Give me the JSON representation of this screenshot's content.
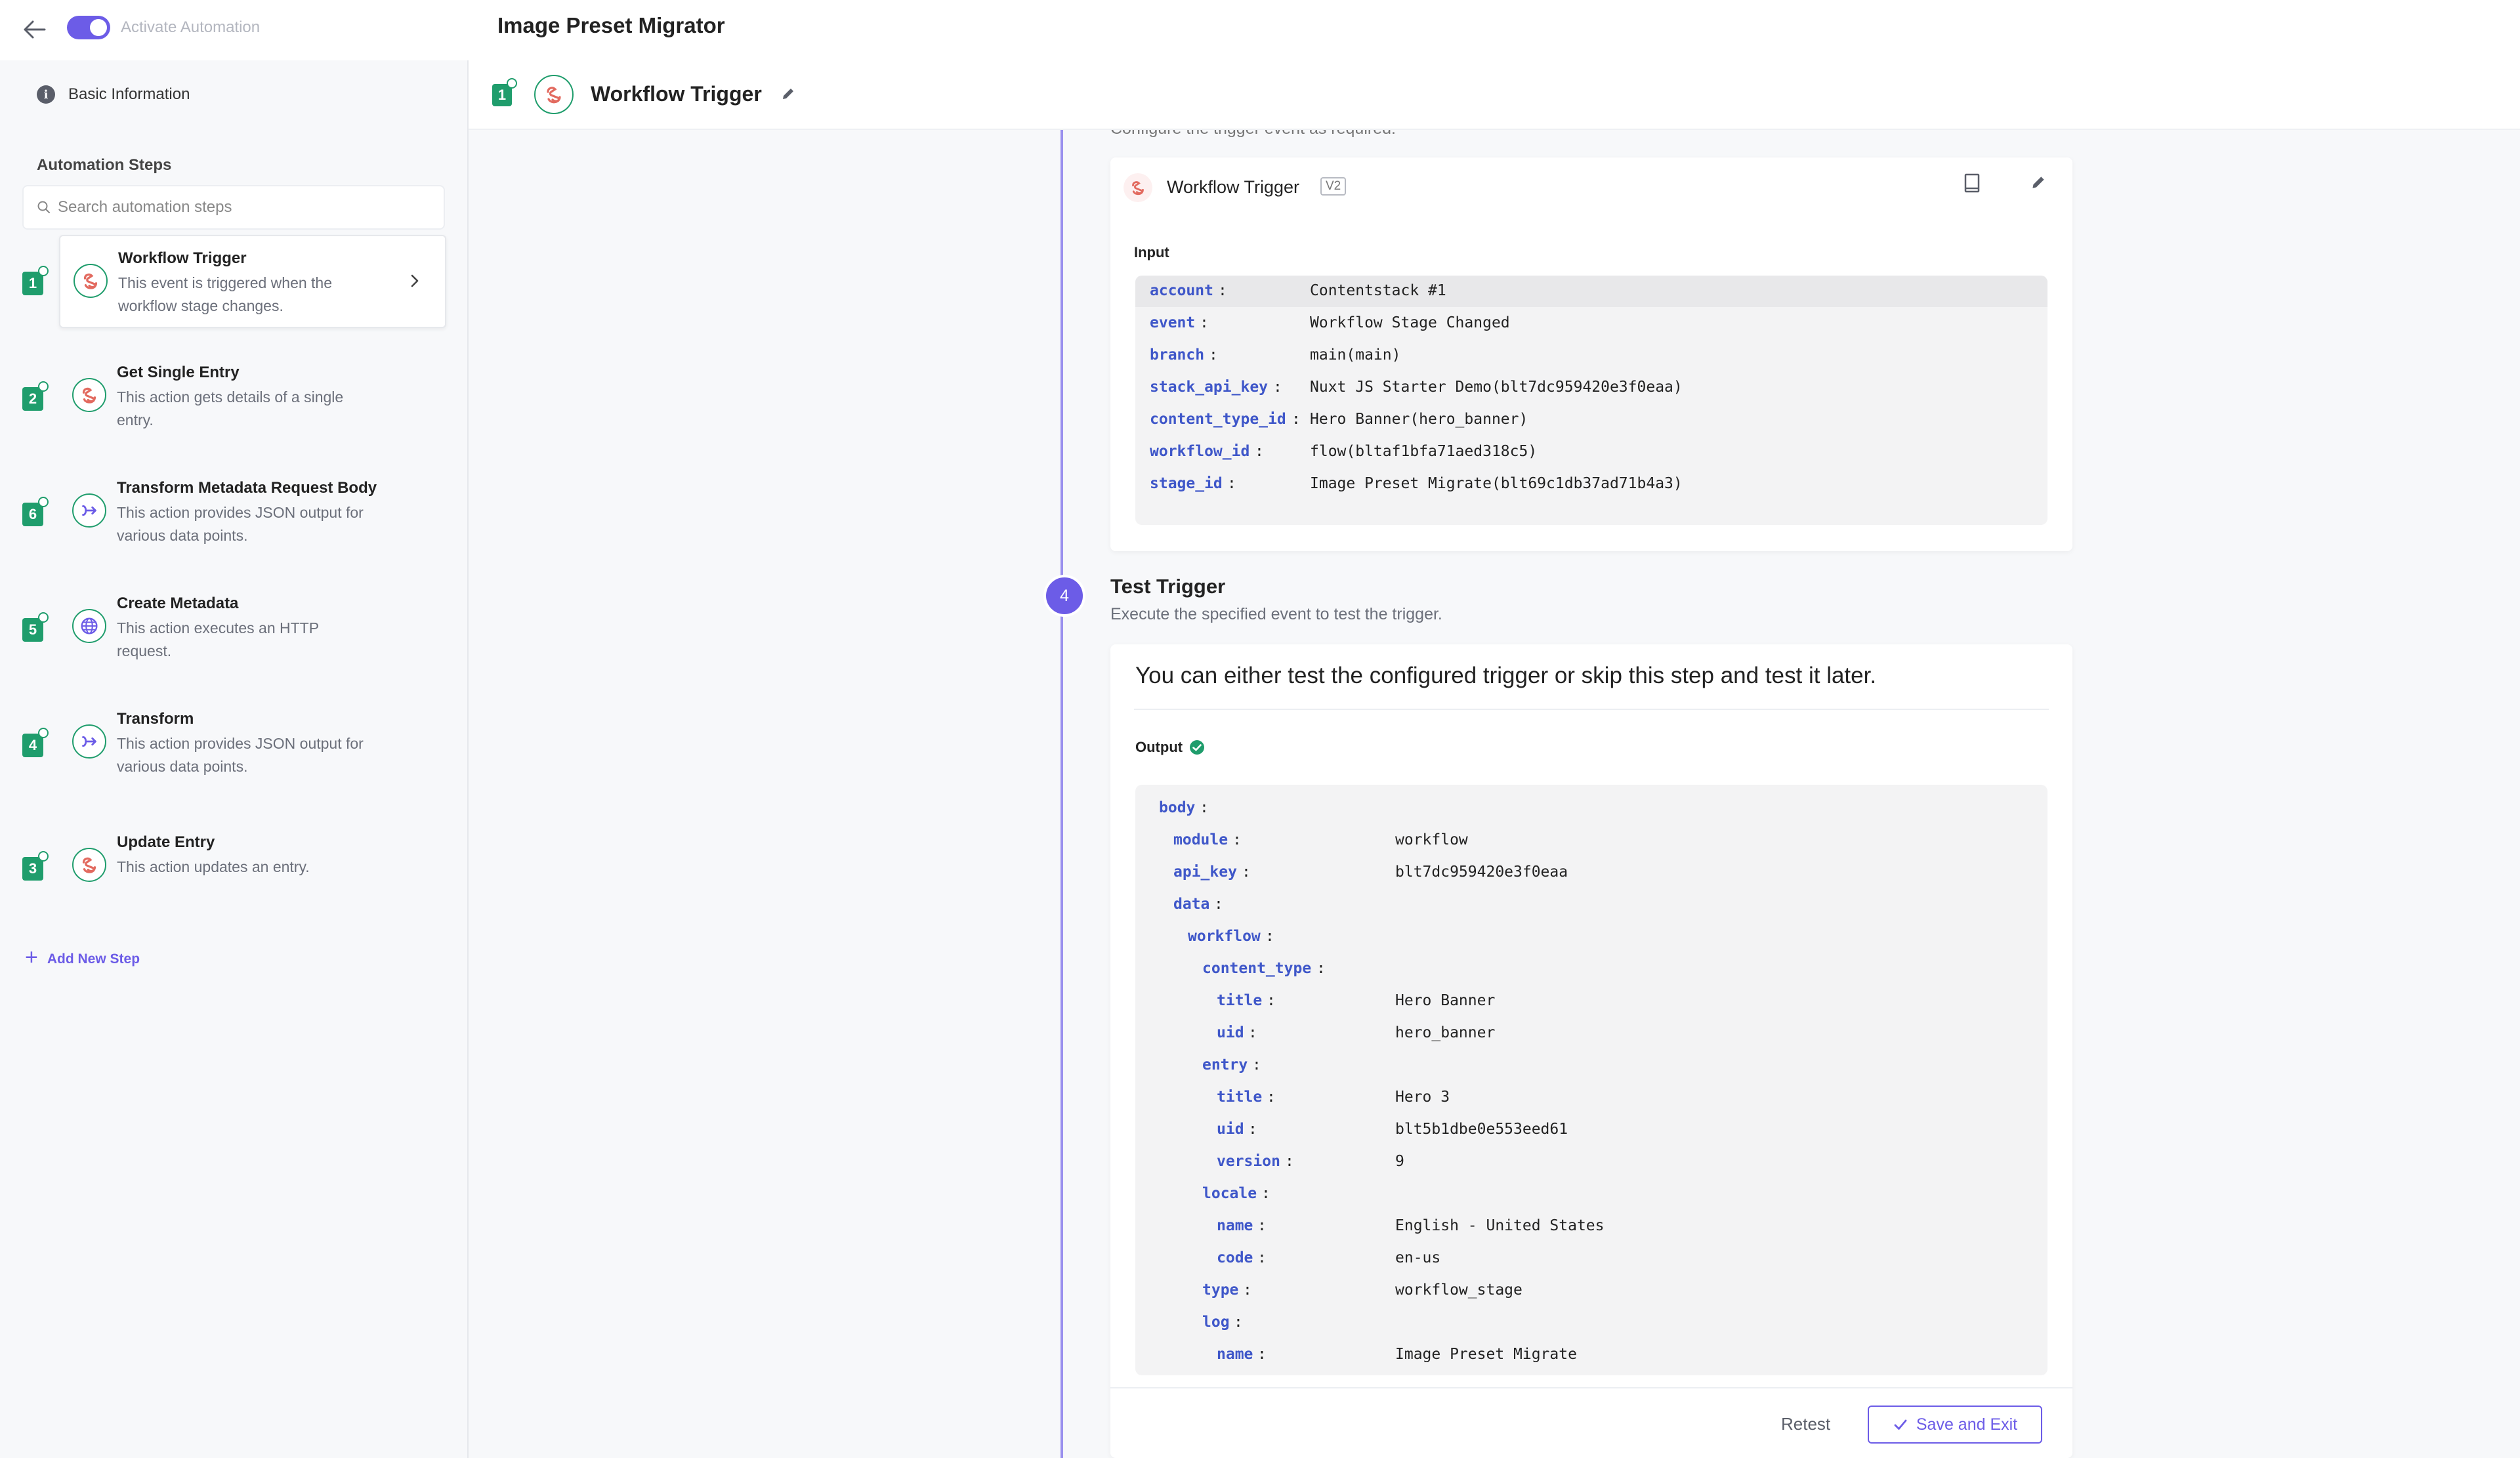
{
  "topbar": {
    "toggle_label": "Activate Automation",
    "title": "Image Preset Migrator"
  },
  "sidebar": {
    "basic_info": "Basic Information",
    "section_title": "Automation Steps",
    "search_placeholder": "Search automation steps",
    "steps": [
      {
        "number": "1",
        "name": "Workflow Trigger",
        "description": "This event is triggered when the workflow stage changes.",
        "icon": "contentstack-icon",
        "active": true
      },
      {
        "number": "2",
        "name": "Get Single Entry",
        "description": "This action gets details of a single entry.",
        "icon": "contentstack-icon"
      },
      {
        "number": "6",
        "name": "Transform Metadata Request Body",
        "description": "This action provides JSON output for various data points.",
        "icon": "transform-icon"
      },
      {
        "number": "5",
        "name": "Create Metadata",
        "description": "This action executes an HTTP request.",
        "icon": "globe-icon"
      },
      {
        "number": "4",
        "name": "Transform",
        "description": "This action provides JSON output for various data points.",
        "icon": "transform-icon"
      },
      {
        "number": "3",
        "name": "Update Entry",
        "description": "This action updates an entry.",
        "icon": "contentstack-icon"
      }
    ],
    "add_step": "Add New Step"
  },
  "subheader": {
    "number": "1",
    "title": "Workflow Trigger"
  },
  "config": {
    "cut_text": "Configure the trigger event as required.",
    "card_title": "Workflow Trigger",
    "badge": "V2",
    "input_label": "Input",
    "rows": [
      {
        "key": "account",
        "value": "Contentstack #1"
      },
      {
        "key": "event",
        "value": "Workflow Stage Changed"
      },
      {
        "key": "branch",
        "value": "main(main)"
      },
      {
        "key": "stack_api_key",
        "value": "Nuxt JS Starter Demo(blt7dc959420e3f0eaa)"
      },
      {
        "key": "content_type_id",
        "value": "Hero Banner(hero_banner)"
      },
      {
        "key": "workflow_id",
        "value": "flow(bltaf1bfa71aed318c5)"
      },
      {
        "key": "stage_id",
        "value": "Image Preset Migrate(blt69c1db37ad71b4a3)"
      }
    ]
  },
  "test_trigger": {
    "step_number": "4",
    "title": "Test Trigger",
    "description": "Execute the specified event to test the trigger.",
    "message": "You can either test the configured trigger or skip this step and test it later.",
    "output_label": "Output",
    "rows": [
      {
        "key": "body",
        "value": "",
        "indent": 0
      },
      {
        "key": "module",
        "value": "workflow",
        "indent": 1
      },
      {
        "key": "api_key",
        "value": "blt7dc959420e3f0eaa",
        "indent": 1
      },
      {
        "key": "data",
        "value": "",
        "indent": 1
      },
      {
        "key": "workflow",
        "value": "",
        "indent": 2
      },
      {
        "key": "content_type",
        "value": "",
        "indent": 3
      },
      {
        "key": "title",
        "value": "Hero Banner",
        "indent": 4
      },
      {
        "key": "uid",
        "value": "hero_banner",
        "indent": 4
      },
      {
        "key": "entry",
        "value": "",
        "indent": 3
      },
      {
        "key": "title",
        "value": "Hero 3",
        "indent": 4
      },
      {
        "key": "uid",
        "value": "blt5b1dbe0e553eed61",
        "indent": 4
      },
      {
        "key": "version",
        "value": "9",
        "indent": 4
      },
      {
        "key": "locale",
        "value": "",
        "indent": 3
      },
      {
        "key": "name",
        "value": "English - United States",
        "indent": 4
      },
      {
        "key": "code",
        "value": "en-us",
        "indent": 4
      },
      {
        "key": "type",
        "value": "workflow_stage",
        "indent": 3
      },
      {
        "key": "log",
        "value": "",
        "indent": 3
      },
      {
        "key": "name",
        "value": "Image Preset Migrate",
        "indent": 4
      }
    ],
    "retest": "Retest",
    "save_exit": "Save and Exit"
  },
  "colors": {
    "accent": "#6c5ce7",
    "success": "#1f9d6c",
    "key": "#3f57c9"
  }
}
